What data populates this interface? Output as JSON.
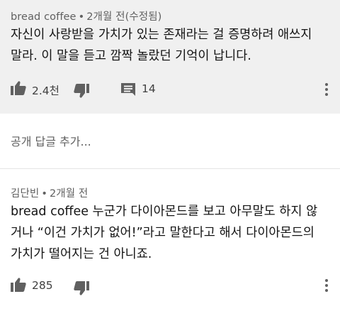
{
  "comment1": {
    "author": "bread coffee",
    "separator": "•",
    "time": "2개월 전(수정됨)",
    "lines": [
      "자신이 사랑받을 가치가 있는 존재라는 걸 증명하려 애쓰지",
      "말라. 이 말을 듣고 깜짝 놀랐던 기억이 납니다."
    ],
    "like_count": "2.4천",
    "reply_count": "14"
  },
  "add_reply_placeholder": "공개 답글 추가...",
  "comment2": {
    "author": "김단빈",
    "separator": "•",
    "time": "2개월 전",
    "lines": [
      "bread coffee 누군가 다이아몬드를 보고 아무말도 하지 않",
      "거나 “이건 가치가 없어!”라고 말한다고 해서 다이아몬드의",
      "가치가 떨어지는 건 아니죠."
    ],
    "like_count": "285"
  },
  "icons": [
    "thumb-up-icon",
    "thumb-down-icon",
    "comment-icon",
    "more-vert-icon"
  ],
  "colors": {
    "highlight_bg": "#f0f0f0",
    "meta_text": "#606060",
    "icon": "#606060"
  }
}
